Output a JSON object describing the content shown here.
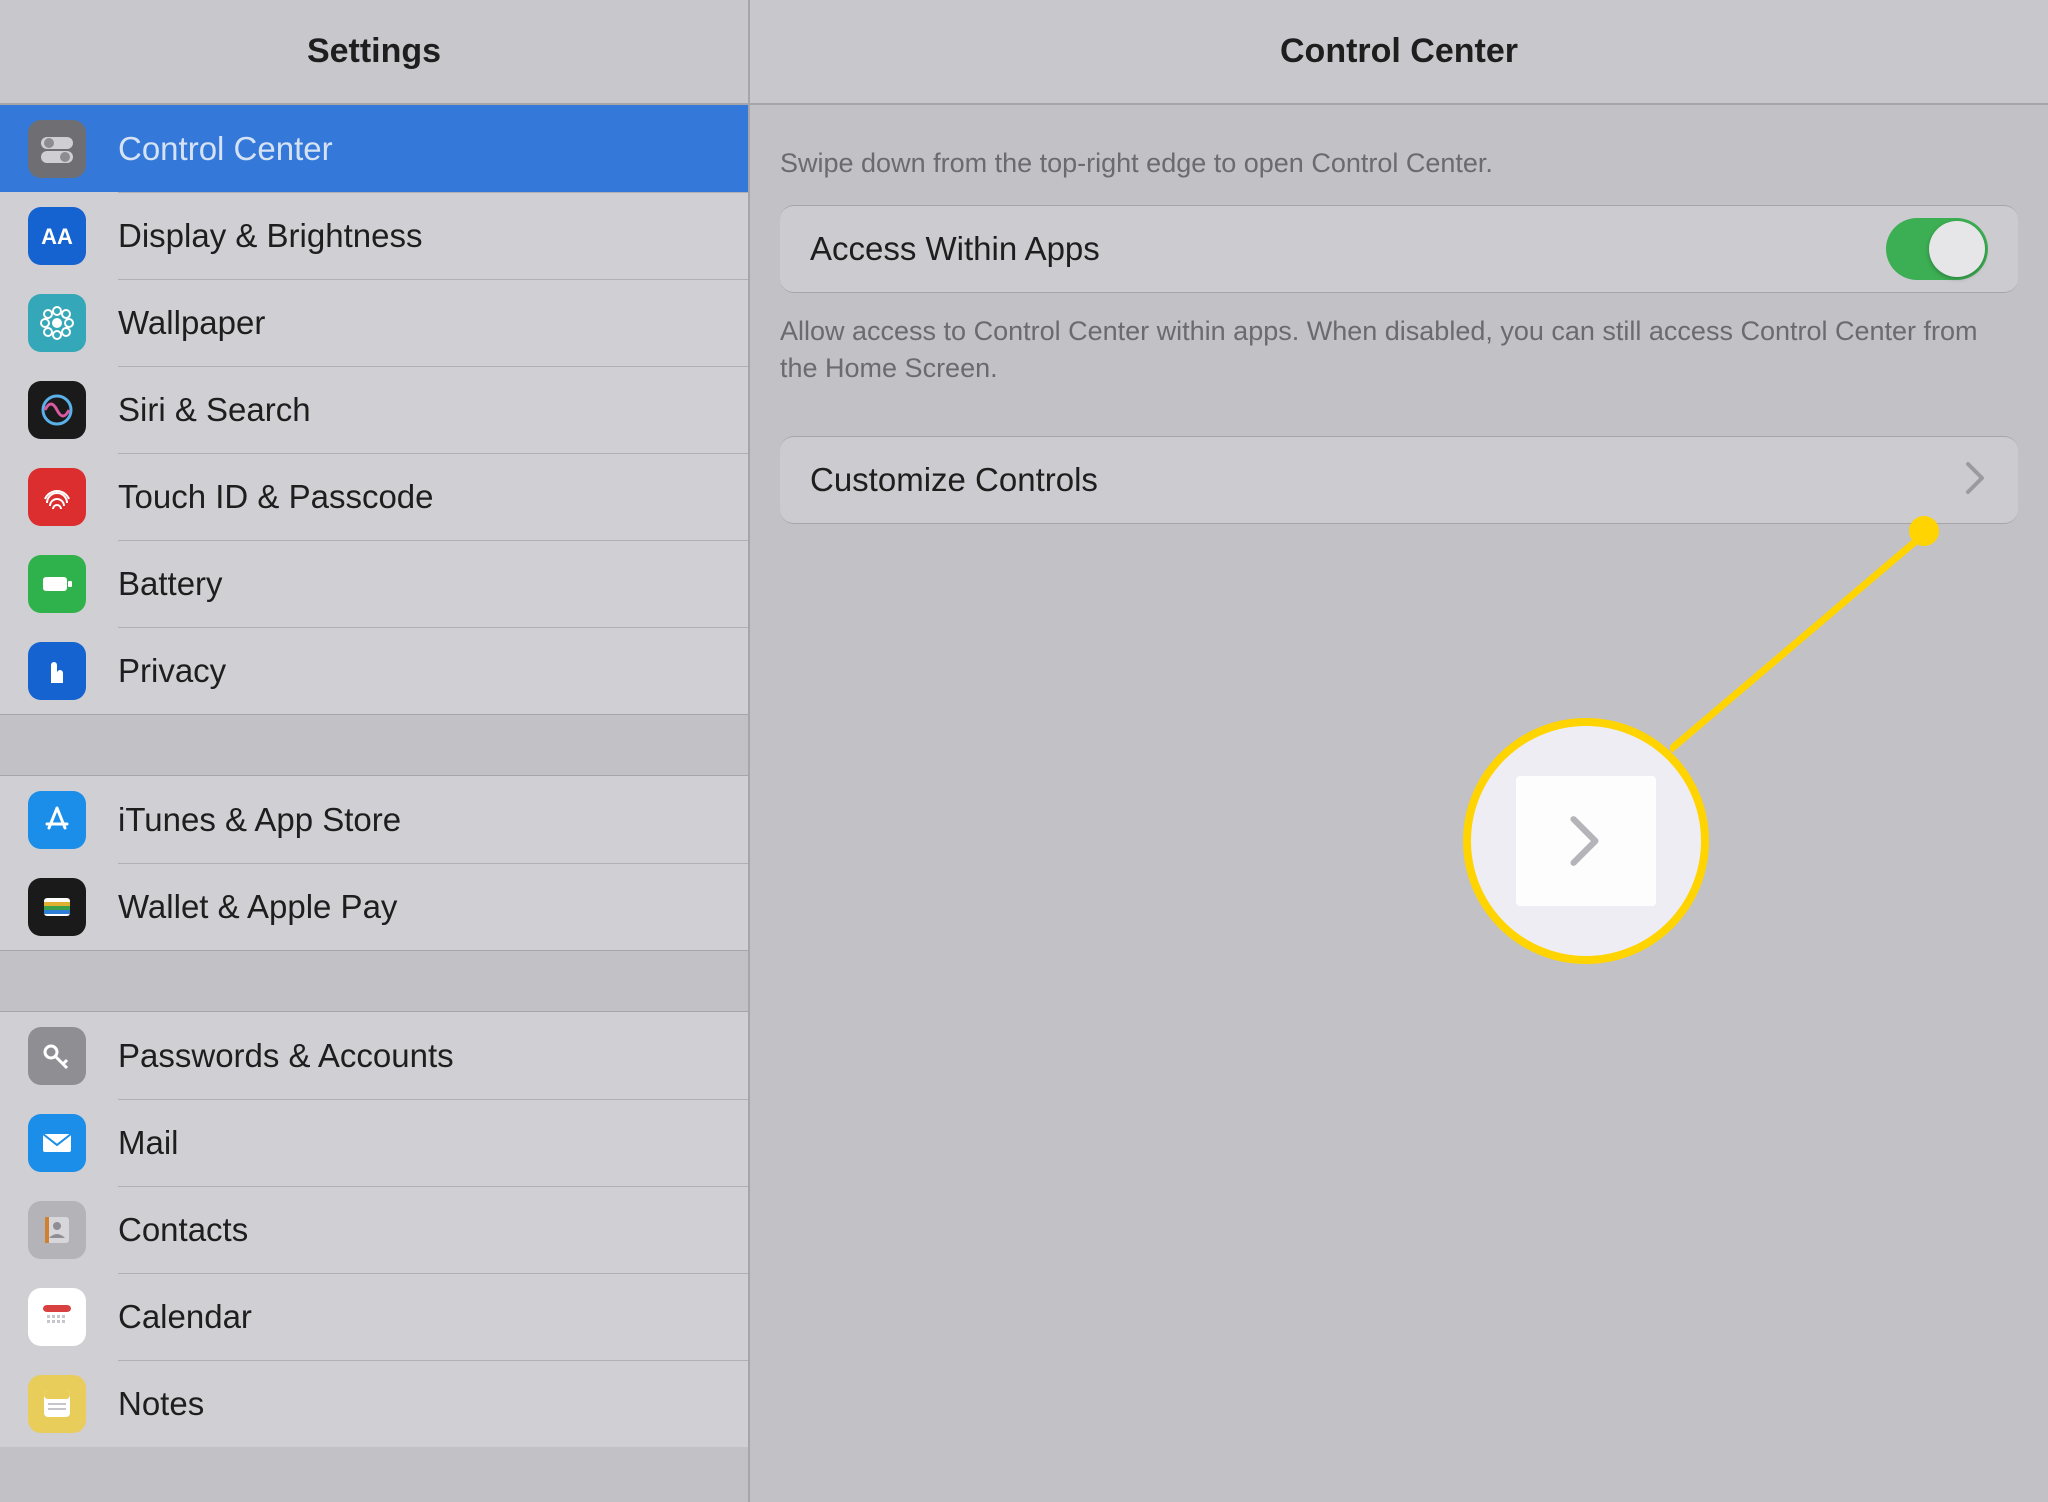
{
  "sidebar": {
    "title": "Settings",
    "groups": [
      [
        {
          "key": "control-center",
          "label": "Control Center",
          "selected": true,
          "icon": "cc",
          "bg": "#6f6e72"
        },
        {
          "key": "display-brightness",
          "label": "Display & Brightness",
          "icon": "aa",
          "bg": "#1463d1"
        },
        {
          "key": "wallpaper",
          "label": "Wallpaper",
          "icon": "flower",
          "bg": "#34a7b8"
        },
        {
          "key": "siri-search",
          "label": "Siri & Search",
          "icon": "siri",
          "bg": "#1a1a1a"
        },
        {
          "key": "touch-id",
          "label": "Touch ID & Passcode",
          "icon": "fingerprint",
          "bg": "#dc2e2e"
        },
        {
          "key": "battery",
          "label": "Battery",
          "icon": "battery",
          "bg": "#2fb24b"
        },
        {
          "key": "privacy",
          "label": "Privacy",
          "icon": "hand",
          "bg": "#1463d1"
        }
      ],
      [
        {
          "key": "itunes",
          "label": "iTunes & App Store",
          "icon": "appstore",
          "bg": "#1a8ee8"
        },
        {
          "key": "wallet",
          "label": "Wallet & Apple Pay",
          "icon": "wallet",
          "bg": "#1a1a1a"
        }
      ],
      [
        {
          "key": "passwords",
          "label": "Passwords & Accounts",
          "icon": "key",
          "bg": "#8f8e92"
        },
        {
          "key": "mail",
          "label": "Mail",
          "icon": "mail",
          "bg": "#1a8ee8"
        },
        {
          "key": "contacts",
          "label": "Contacts",
          "icon": "contacts",
          "bg": "#b4b3b7"
        },
        {
          "key": "calendar",
          "label": "Calendar",
          "icon": "calendar",
          "bg": "#ffffff"
        },
        {
          "key": "notes",
          "label": "Notes",
          "icon": "notes",
          "bg": "#e9cd5a"
        }
      ]
    ]
  },
  "detail": {
    "title": "Control Center",
    "hint": "Swipe down from the top-right edge to open Control Center.",
    "accessLabel": "Access Within Apps",
    "accessOn": true,
    "accessCaption": "Allow access to Control Center within apps. When disabled, you can still access Control Center from the Home Screen.",
    "customizeLabel": "Customize Controls"
  }
}
